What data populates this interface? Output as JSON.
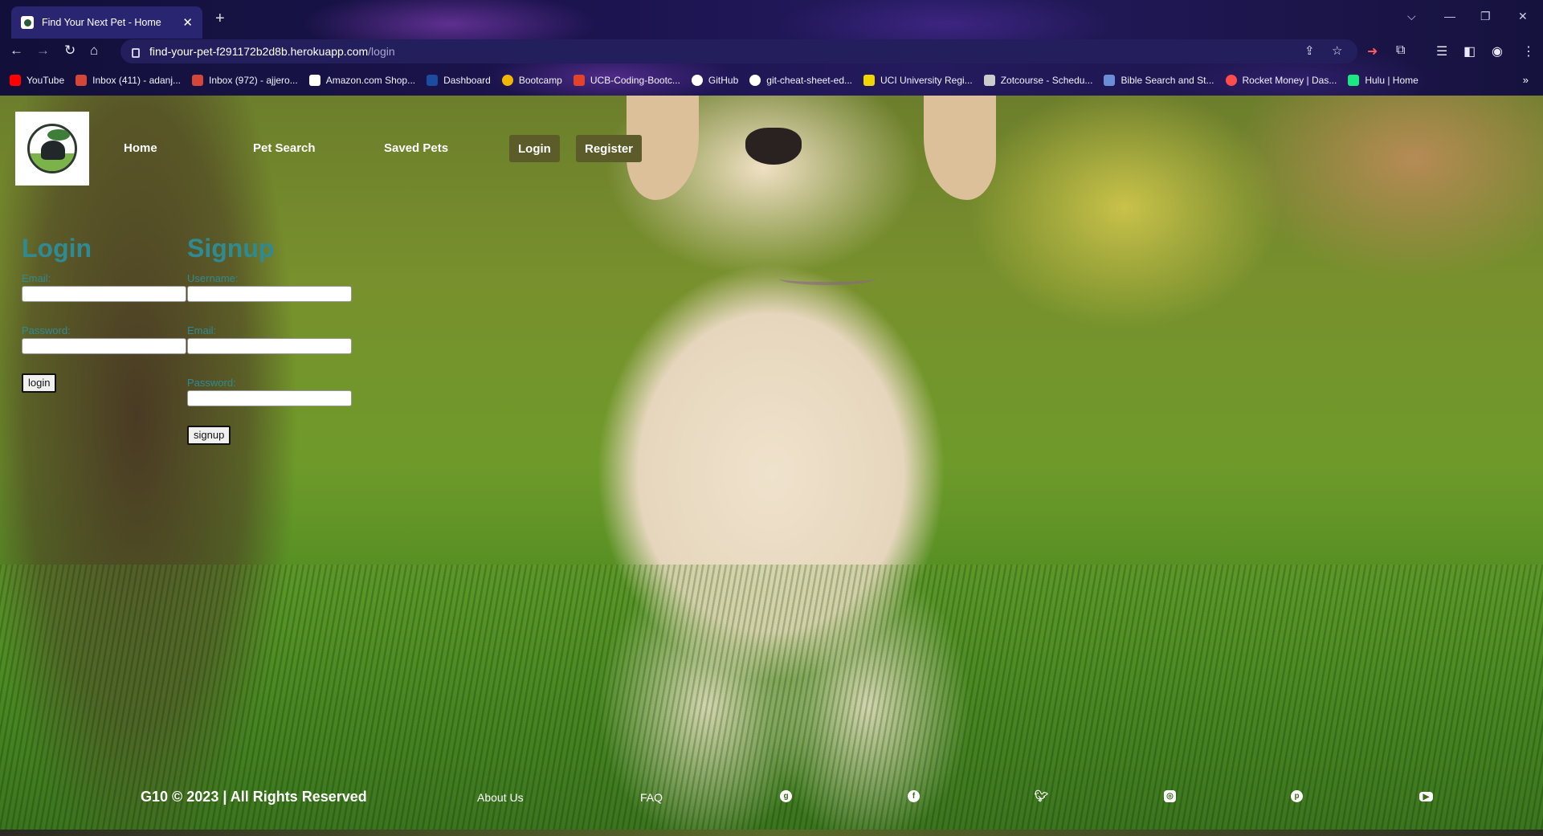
{
  "browser": {
    "tab_title": "Find Your Next Pet - Home",
    "tab_close": "✕",
    "new_tab": "+",
    "url_host": "find-your-pet-f291172b2d8b.herokuapp.com",
    "url_path": "/login",
    "window_controls": {
      "menu": "⌵",
      "minimize": "—",
      "restore": "❐",
      "close": "✕"
    },
    "bookmarks": [
      {
        "label": "YouTube",
        "color": "#ff0000"
      },
      {
        "label": "Inbox (411) - adanj...",
        "color": "#d44638"
      },
      {
        "label": "Inbox (972) - ajjero...",
        "color": "#d44638"
      },
      {
        "label": "Amazon.com Shop...",
        "color": "#ffffff"
      },
      {
        "label": "Dashboard",
        "color": "#1d4ba0"
      },
      {
        "label": "Bootcamp",
        "color": "#f2b705"
      },
      {
        "label": "UCB-Coding-Bootc...",
        "color": "#e2432a"
      },
      {
        "label": "GitHub",
        "color": "#ffffff"
      },
      {
        "label": "git-cheat-sheet-ed...",
        "color": "#ffffff"
      },
      {
        "label": "UCI University Regi...",
        "color": "#f2d600"
      },
      {
        "label": "Zotcourse - Schedu...",
        "color": "#cccccc"
      },
      {
        "label": "Bible Search and St...",
        "color": "#6a8fd8"
      },
      {
        "label": "Rocket Money | Das...",
        "color": "#ff4d4d"
      },
      {
        "label": "Hulu | Home",
        "color": "#1ce783"
      }
    ],
    "bookmarks_more": "»"
  },
  "nav": {
    "home": "Home",
    "pet_search": "Pet Search",
    "saved_pets": "Saved Pets",
    "login": "Login",
    "register": "Register"
  },
  "login_form": {
    "heading": "Login",
    "email_label": "Email:",
    "password_label": "Password:",
    "submit": "login"
  },
  "signup_form": {
    "heading": "Signup",
    "username_label": "Username:",
    "email_label": "Email:",
    "password_label": "Password:",
    "submit": "signup"
  },
  "footer": {
    "copyright": "G10 © 2023 | All Rights Reserved",
    "about": "About Us",
    "faq": "FAQ",
    "social": [
      "github-icon",
      "facebook-icon",
      "twitter-icon",
      "instagram-icon",
      "pinterest-icon",
      "youtube-icon"
    ]
  }
}
